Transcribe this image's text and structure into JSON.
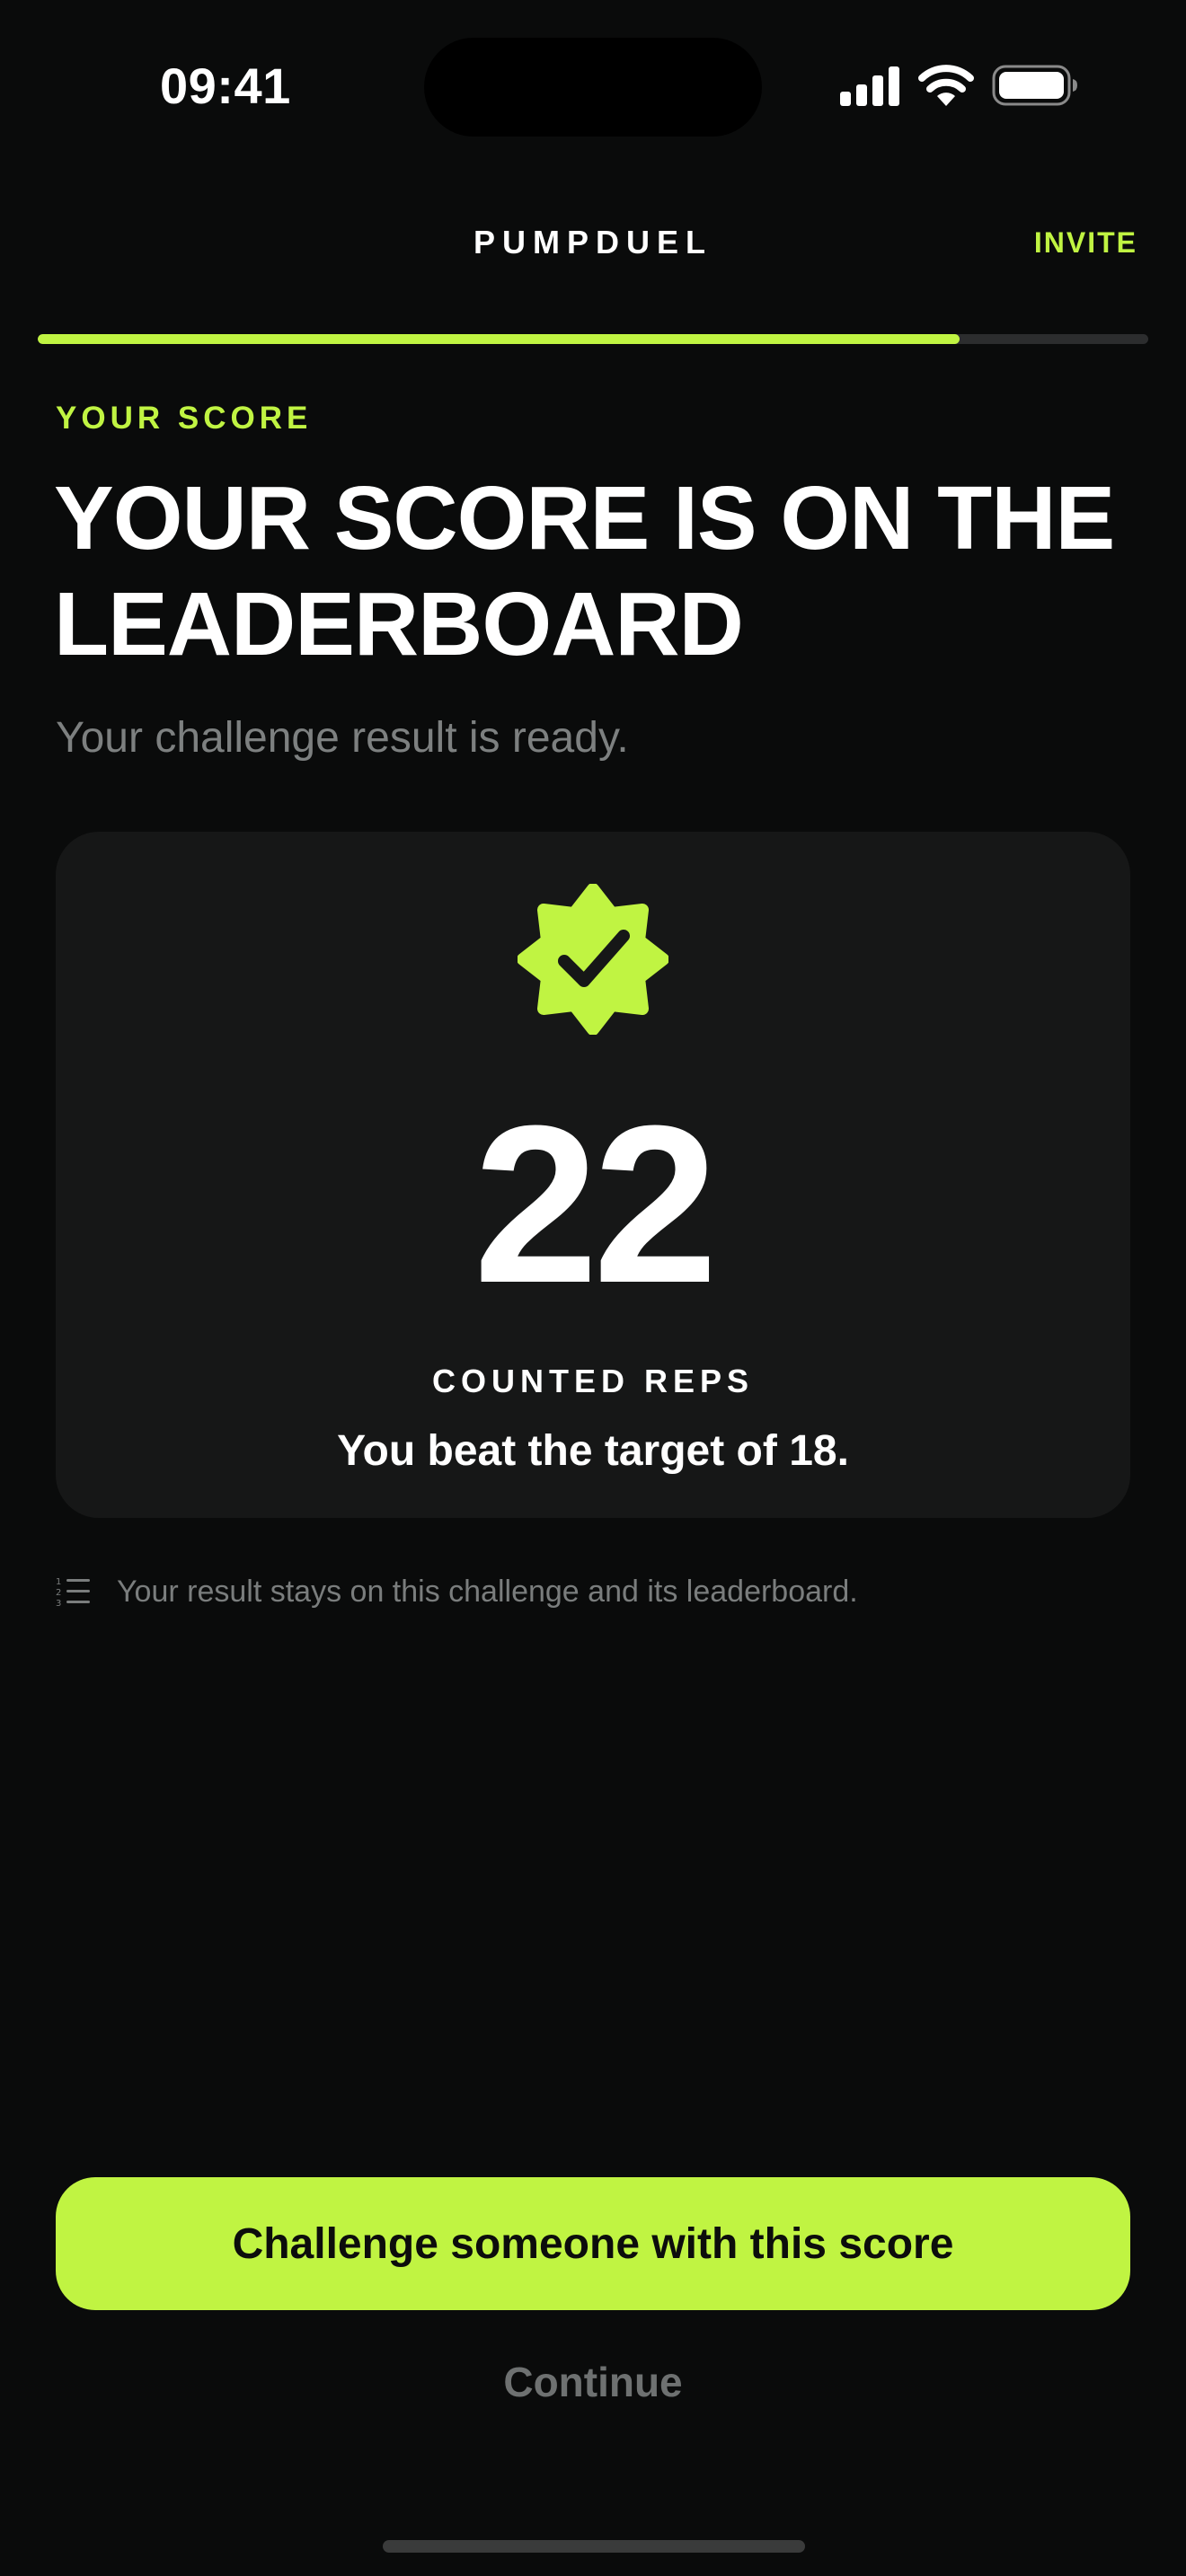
{
  "status_bar": {
    "time": "09:41",
    "icons": [
      "signal-icon",
      "wifi-icon",
      "battery-icon"
    ]
  },
  "header": {
    "title": "PUMPDUEL",
    "invite_label": "INVITE"
  },
  "progress": {
    "value_fraction": 0.83
  },
  "main": {
    "eyebrow": "YOUR SCORE",
    "headline": "YOUR SCORE IS ON THE LEADERBOARD",
    "subtitle": "Your challenge result is ready."
  },
  "score_card": {
    "badge_icon": "verified-check-badge-icon",
    "score": "22",
    "label": "COUNTED REPS",
    "detail": "You beat the target of 18."
  },
  "footnote": {
    "icon": "numbered-list-icon",
    "text": "Your result stays on this challenge and its leaderboard."
  },
  "actions": {
    "primary_label": "Challenge someone with this score",
    "secondary_label": "Continue"
  },
  "colors": {
    "background": "#0a0b0b",
    "accent": "#c0f442",
    "card": "#161717",
    "muted_text": "#7d8080"
  }
}
